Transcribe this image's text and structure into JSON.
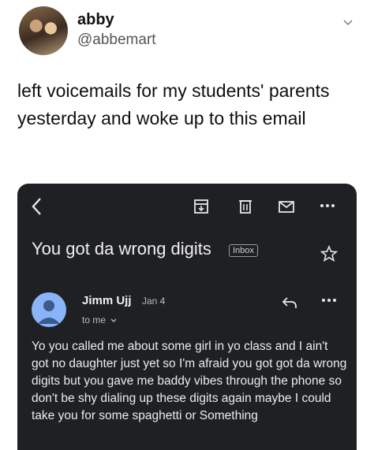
{
  "header": {
    "name": "abby",
    "handle": "@abbemart"
  },
  "tweet": {
    "text": "left voicemails for my students' parents yesterday and woke up to this email"
  },
  "email": {
    "subject": "You got da wrong digits",
    "label": "Inbox",
    "sender": "Jimm Ujj",
    "date": "Jan 4",
    "recipient": "to me",
    "body": "Yo you called me about some girl in yo class and I ain't got no daughter just yet so I'm afraid you got got da wrong digits but you gave me baddy vibes through the phone so don't be shy dialing up these digits again maybe I could take you for some spaghetti or Something"
  },
  "colors": {
    "card_bg": "#1f2023",
    "avatar_blue": "#8ab4f8"
  },
  "icons": [
    "back-arrow-icon",
    "archive-icon",
    "delete-icon",
    "mark-unread-icon",
    "more-icon",
    "star-icon",
    "reply-icon",
    "chevron-down-icon"
  ]
}
